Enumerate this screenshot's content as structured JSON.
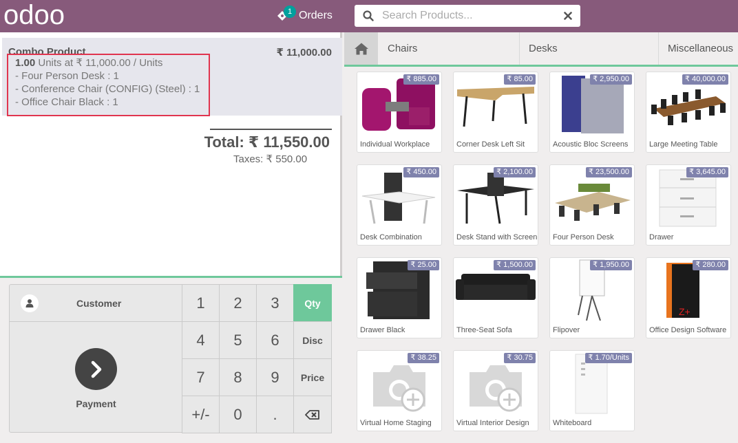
{
  "header": {
    "logo_text": "odoo",
    "orders_label": "Orders",
    "orders_count": "1",
    "search_placeholder": "Search Products..."
  },
  "order": {
    "line": {
      "product_name": "Combo Product",
      "price": "₹ 11,000.00",
      "qty": "1.00",
      "unit_info": "Units at ₹ 11,000.00 / Units",
      "components": [
        "- Four Person Desk : 1",
        "- Conference Chair (CONFIG) (Steel) : 1",
        "- Office Chair Black : 1"
      ]
    },
    "total": "Total: ₹ 11,550.00",
    "taxes": "Taxes: ₹ 550.00"
  },
  "actionpad": {
    "customer_label": "Customer",
    "payment_label": "Payment"
  },
  "numpad": {
    "keys": [
      "1",
      "2",
      "3",
      "Qty",
      "4",
      "5",
      "6",
      "Disc",
      "7",
      "8",
      "9",
      "Price",
      "+/-",
      "0",
      "."
    ],
    "active_mode": "Qty"
  },
  "categories": [
    "Chairs",
    "Desks",
    "Miscellaneous"
  ],
  "products": [
    {
      "name": "Individual Workplace",
      "price": "₹ 885.00"
    },
    {
      "name": "Corner Desk Left Sit",
      "price": "₹ 85.00"
    },
    {
      "name": "Acoustic Bloc Screens",
      "price": "₹ 2,950.00"
    },
    {
      "name": "Large Meeting Table",
      "price": "₹ 40,000.00"
    },
    {
      "name": "Desk Combination",
      "price": "₹ 450.00"
    },
    {
      "name": "Desk Stand with Screen",
      "price": "₹ 2,100.00"
    },
    {
      "name": "Four Person Desk",
      "price": "₹ 23,500.00"
    },
    {
      "name": "Drawer",
      "price": "₹ 3,645.00"
    },
    {
      "name": "Drawer Black",
      "price": "₹ 25.00"
    },
    {
      "name": "Three-Seat Sofa",
      "price": "₹ 1,500.00"
    },
    {
      "name": "Flipover",
      "price": "₹ 1,950.00"
    },
    {
      "name": "Office Design Software",
      "price": "₹ 280.00"
    },
    {
      "name": "Virtual Home Staging",
      "price": "₹ 38.25"
    },
    {
      "name": "Virtual Interior Design",
      "price": "₹ 30.75"
    },
    {
      "name": "Whiteboard",
      "price": "₹ 1.70/Units"
    }
  ],
  "colors": {
    "brand": "#875a7b",
    "accent": "#6ec89b",
    "price_tag": "#7f82ac",
    "highlight_border": "#e0344e",
    "badge": "#00a09d"
  }
}
